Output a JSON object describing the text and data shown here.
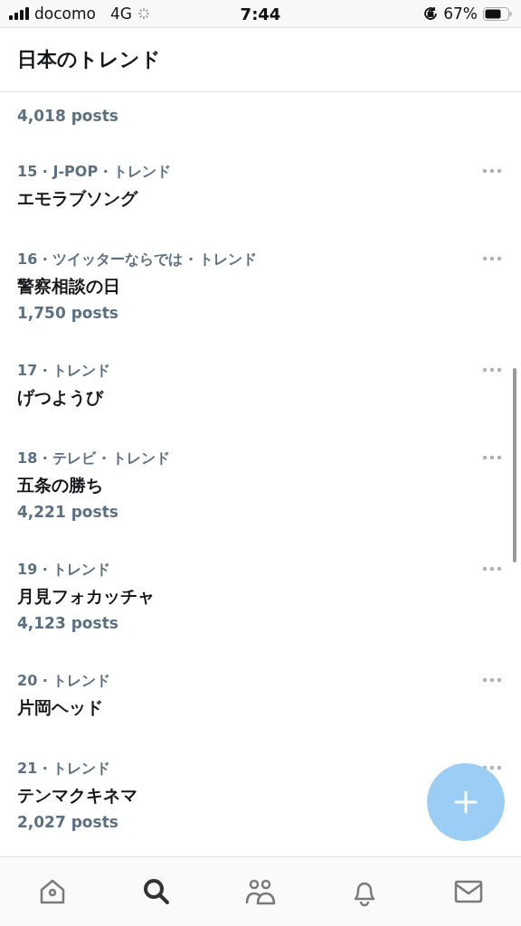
{
  "status_bar": {
    "carrier": "docomo",
    "network": "4G",
    "time": "7:44",
    "battery": "67%"
  },
  "header": {
    "title": "日本のトレンド"
  },
  "partial_item": {
    "posts": "4,018 posts"
  },
  "trends": [
    {
      "meta": "15 · J-POP · トレンド",
      "title": "エモラブソング"
    },
    {
      "meta": "16 · ツイッターならでは · トレンド",
      "title": "警察相談の日",
      "posts": "1,750 posts"
    },
    {
      "meta": "17 · トレンド",
      "title": "げつようび"
    },
    {
      "meta": "18 · テレビ · トレンド",
      "title": "五条の勝ち",
      "posts": "4,221 posts"
    },
    {
      "meta": "19 · トレンド",
      "title": "月見フォカッチャ",
      "posts": "4,123 posts"
    },
    {
      "meta": "20 · トレンド",
      "title": "片岡ヘッド"
    },
    {
      "meta": "21 · トレンド",
      "title": "テンマクキネマ",
      "posts": "2,027 posts"
    }
  ],
  "tab_bar": [
    {
      "kind": "home",
      "selected": false
    },
    {
      "kind": "search",
      "selected": true
    },
    {
      "kind": "people",
      "selected": false
    },
    {
      "kind": "bell",
      "selected": false
    },
    {
      "kind": "mail",
      "selected": false
    }
  ]
}
